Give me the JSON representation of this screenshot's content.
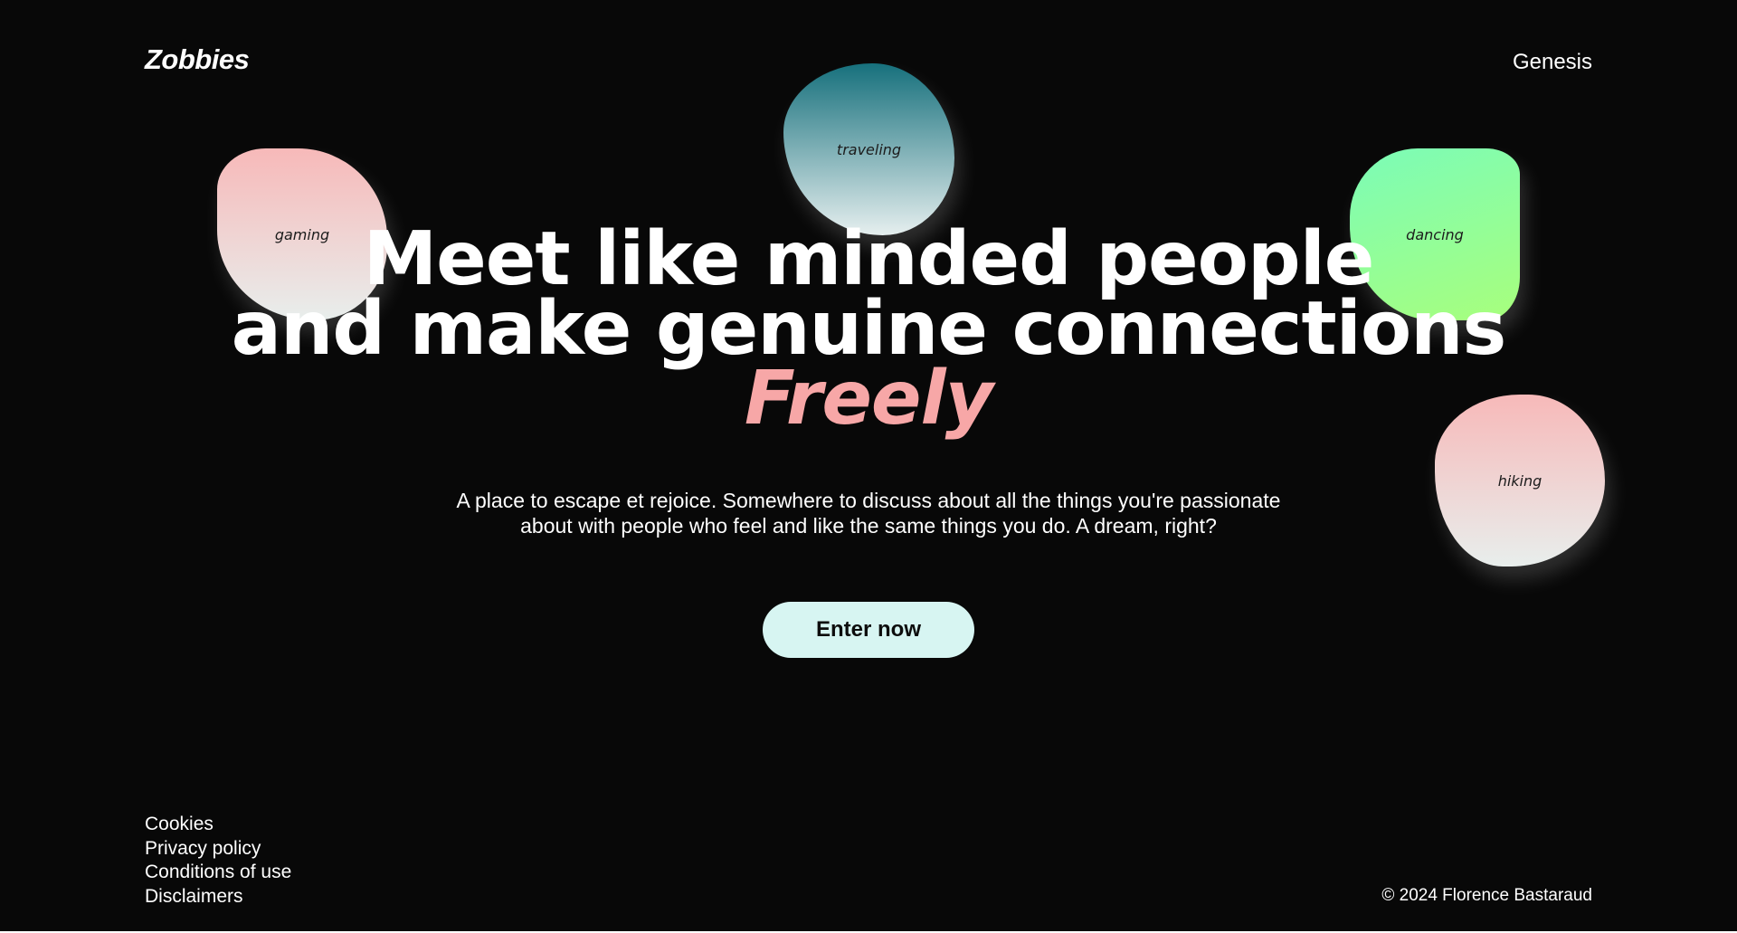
{
  "header": {
    "logo": "Zobbies",
    "nav_link": "Genesis"
  },
  "bubbles": [
    {
      "label": "gaming",
      "colors": [
        "#f7b9b9",
        "#e8eeec"
      ]
    },
    {
      "label": "traveling",
      "colors": [
        "#16707c",
        "#e6efef"
      ]
    },
    {
      "label": "dancing",
      "colors": [
        "#7bfcb8",
        "#a8ff7c"
      ]
    },
    {
      "label": "hiking",
      "colors": [
        "#f7b9b9",
        "#e8eeec"
      ]
    }
  ],
  "hero": {
    "headline_line1": "Meet like minded people",
    "headline_line2": "and make genuine connections",
    "headline_accent": "Freely",
    "accent_color": "#f7a7a7",
    "tagline": "A place to escape et rejoice. Somewhere to discuss about all the things you're passionate about with people who feel and like the same things you do. A dream, right?",
    "cta_label": "Enter now",
    "cta_color": "#d7f5f2"
  },
  "footer": {
    "links": [
      "Cookies",
      "Privacy policy",
      "Conditions of use",
      "Disclaimers"
    ],
    "copyright": "© 2024 Florence Bastaraud"
  },
  "theme": {
    "background": "#080808",
    "text": "#ffffff"
  }
}
